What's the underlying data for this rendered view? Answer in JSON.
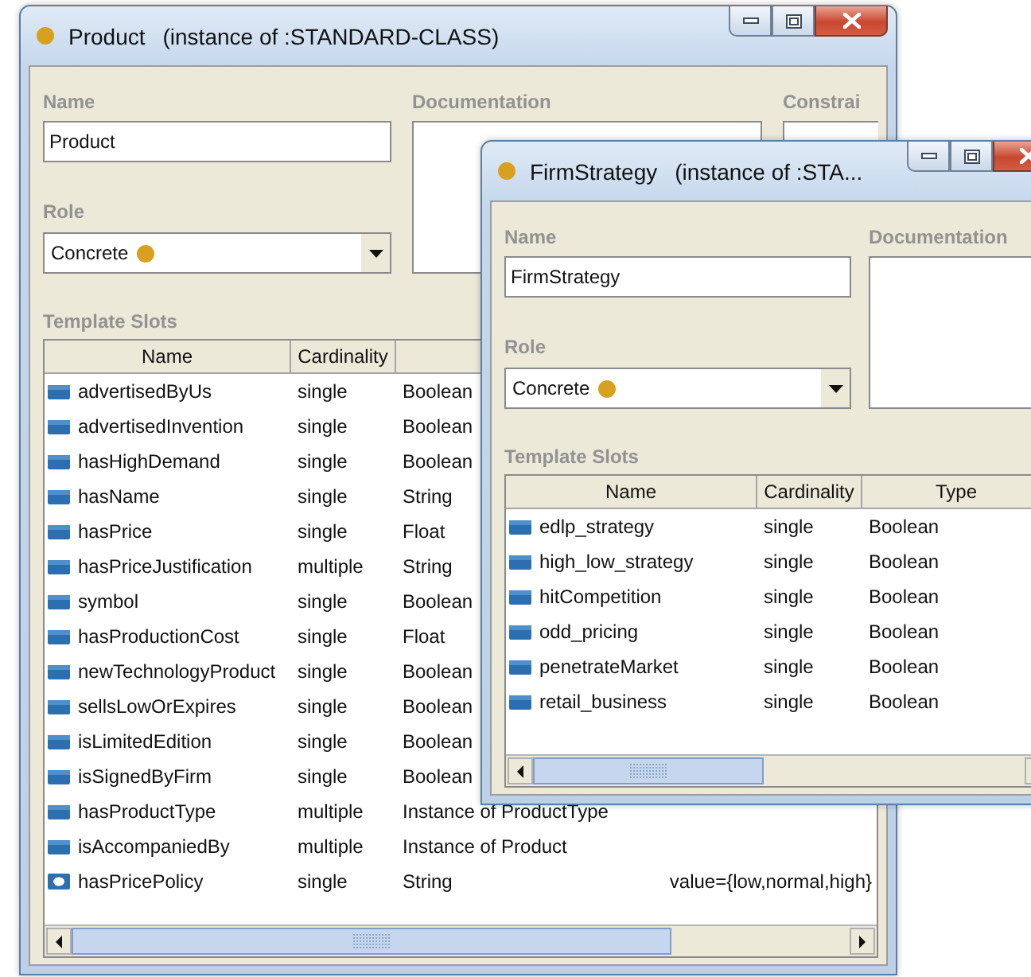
{
  "windows": [
    {
      "title": "Product",
      "subtitle": "(instance of :STANDARD-CLASS)",
      "name_label": "Name",
      "name_value": "Product",
      "documentation_label": "Documentation",
      "constraints_label": "Constrai",
      "role_label": "Role",
      "role_value": "Concrete",
      "slots_label": "Template Slots",
      "columns": [
        "Name",
        "Cardinality",
        "",
        ""
      ],
      "rows": [
        {
          "kind": "slot",
          "name": "advertisedByUs",
          "cardinality": "single",
          "type": "Boolean"
        },
        {
          "kind": "slot",
          "name": "advertisedInvention",
          "cardinality": "single",
          "type": "Boolean"
        },
        {
          "kind": "slot",
          "name": "hasHighDemand",
          "cardinality": "single",
          "type": "Boolean"
        },
        {
          "kind": "slot",
          "name": "hasName",
          "cardinality": "single",
          "type": "String"
        },
        {
          "kind": "slot",
          "name": "hasPrice",
          "cardinality": "single",
          "type": "Float"
        },
        {
          "kind": "slot",
          "name": "hasPriceJustification",
          "cardinality": "multiple",
          "type": "String"
        },
        {
          "kind": "slot",
          "name": "symbol",
          "cardinality": "single",
          "type": "Boolean"
        },
        {
          "kind": "slot",
          "name": "hasProductionCost",
          "cardinality": "single",
          "type": "Float"
        },
        {
          "kind": "slot",
          "name": "newTechnologyProduct",
          "cardinality": "single",
          "type": "Boolean"
        },
        {
          "kind": "slot",
          "name": "sellsLowOrExpires",
          "cardinality": "single",
          "type": "Boolean"
        },
        {
          "kind": "slot",
          "name": "isLimitedEdition",
          "cardinality": "single",
          "type": "Boolean"
        },
        {
          "kind": "slot",
          "name": "isSignedByFirm",
          "cardinality": "single",
          "type": "Boolean"
        },
        {
          "kind": "slot",
          "name": "hasProductType",
          "cardinality": "multiple",
          "type": "Instance of ProductType"
        },
        {
          "kind": "slot",
          "name": "isAccompaniedBy",
          "cardinality": "multiple",
          "type": "Instance of Product"
        },
        {
          "kind": "enum",
          "name": "hasPricePolicy",
          "cardinality": "single",
          "type": "String",
          "other": "value={low,normal,high}"
        }
      ]
    },
    {
      "title": "FirmStrategy",
      "subtitle": "(instance of :STA...",
      "name_label": "Name",
      "name_value": "FirmStrategy",
      "documentation_label": "Documentation",
      "role_label": "Role",
      "role_value": "Concrete",
      "slots_label": "Template Slots",
      "columns": [
        "Name",
        "Cardinality",
        "Type"
      ],
      "rows": [
        {
          "kind": "slot",
          "name": "edlp_strategy",
          "cardinality": "single",
          "type": "Boolean"
        },
        {
          "kind": "slot",
          "name": "high_low_strategy",
          "cardinality": "single",
          "type": "Boolean"
        },
        {
          "kind": "slot",
          "name": "hitCompetition",
          "cardinality": "single",
          "type": "Boolean"
        },
        {
          "kind": "slot",
          "name": "odd_pricing",
          "cardinality": "single",
          "type": "Boolean"
        },
        {
          "kind": "slot",
          "name": "penetrateMarket",
          "cardinality": "single",
          "type": "Boolean"
        },
        {
          "kind": "slot",
          "name": "retail_business",
          "cardinality": "single",
          "type": "Boolean"
        }
      ]
    }
  ]
}
